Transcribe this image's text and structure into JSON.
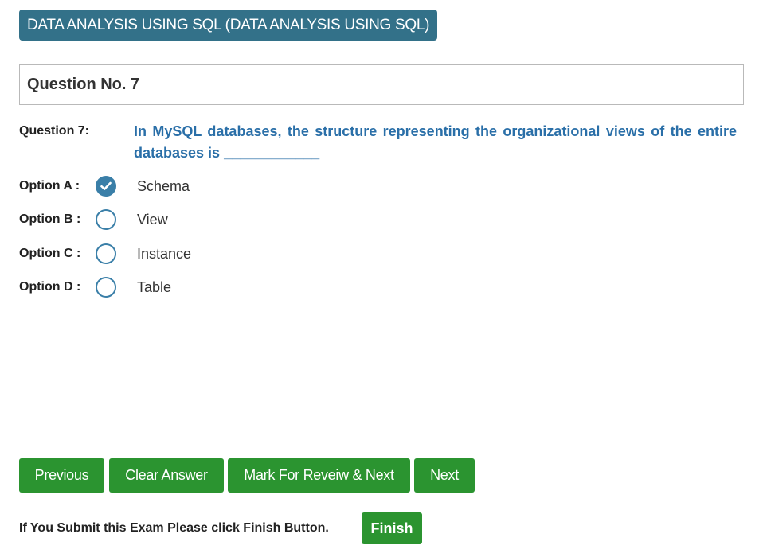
{
  "exam": {
    "subject": "DATA ANALYSIS USING SQL (DATA ANALYSIS USING SQL)"
  },
  "question": {
    "header": "Question No. 7",
    "label": "Question 7:",
    "text": "In MySQL databases, the structure representing the organizational views of the entire databases is ____________"
  },
  "options": [
    {
      "label": "Option A :",
      "text": "Schema",
      "selected": true
    },
    {
      "label": "Option B :",
      "text": "View",
      "selected": false
    },
    {
      "label": "Option C :",
      "text": "Instance",
      "selected": false
    },
    {
      "label": "Option D :",
      "text": "Table",
      "selected": false
    }
  ],
  "actions": {
    "previous": "Previous",
    "clear": "Clear Answer",
    "mark_review": "Mark For Reveiw & Next",
    "next": "Next"
  },
  "footer": {
    "note": "If You Submit this Exam Please click Finish Button.",
    "finish": "Finish"
  },
  "colors": {
    "badge": "#337189",
    "question_text": "#2a6fa8",
    "radio": "#3a7fa8",
    "button": "#2b9430"
  }
}
